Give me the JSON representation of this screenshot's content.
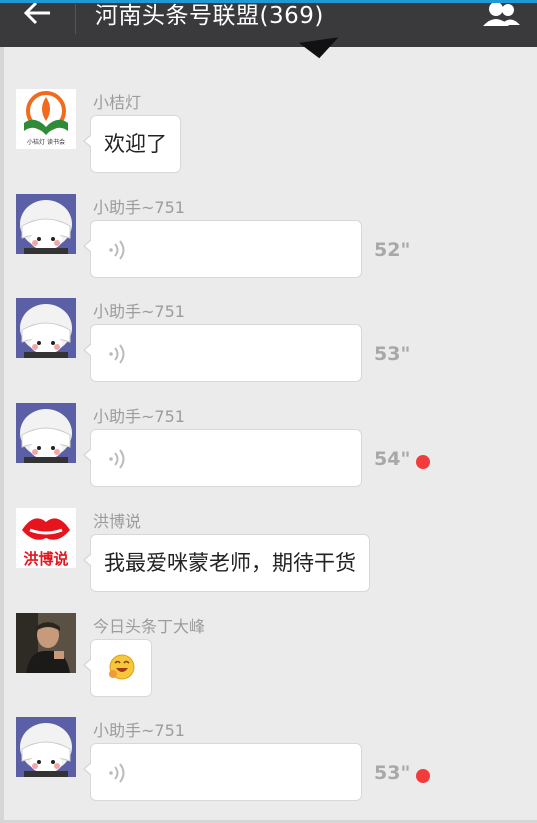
{
  "header": {
    "title": "河南头条号联盟(369)"
  },
  "colors": {
    "header_bg": "#3a3a3c",
    "accent": "#1e9ad6",
    "unread_dot": "#f23c3c",
    "background": "#ebebeb"
  },
  "icons": {
    "back": "arrow-left-icon",
    "members": "group-members-icon",
    "voice": "voice-wave-icon"
  },
  "messages": [
    {
      "sender": "小桔灯",
      "type": "text",
      "text": "欢迎了",
      "avatar_caption": "小桔灯 读书会"
    },
    {
      "sender": "小助手~751",
      "type": "voice",
      "duration": "52\"",
      "unread": false
    },
    {
      "sender": "小助手~751",
      "type": "voice",
      "duration": "53\"",
      "unread": false
    },
    {
      "sender": "小助手~751",
      "type": "voice",
      "duration": "54\"",
      "unread": true
    },
    {
      "sender": "洪博说",
      "type": "text",
      "text": "我最爱咪蒙老师，期待干货",
      "avatar_caption": "洪博说"
    },
    {
      "sender": "今日头条丁大峰",
      "type": "emoji",
      "emoji": "laughing-face-emoji"
    },
    {
      "sender": "小助手~751",
      "type": "voice",
      "duration": "53\"",
      "unread": true
    }
  ]
}
